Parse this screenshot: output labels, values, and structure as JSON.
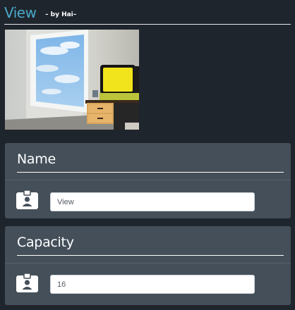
{
  "header": {
    "title": "View",
    "subtitle": "– by Hai–"
  },
  "preview": {
    "alt": "room render preview"
  },
  "panels": [
    {
      "title": "Name",
      "field_value": "View",
      "icon": "id-badge-icon"
    },
    {
      "title": "Capacity",
      "field_value": "16",
      "icon": "id-badge-icon"
    }
  ],
  "colors": {
    "accent": "#4aa8c9",
    "panel": "#444f59",
    "background": "#1f252c"
  }
}
